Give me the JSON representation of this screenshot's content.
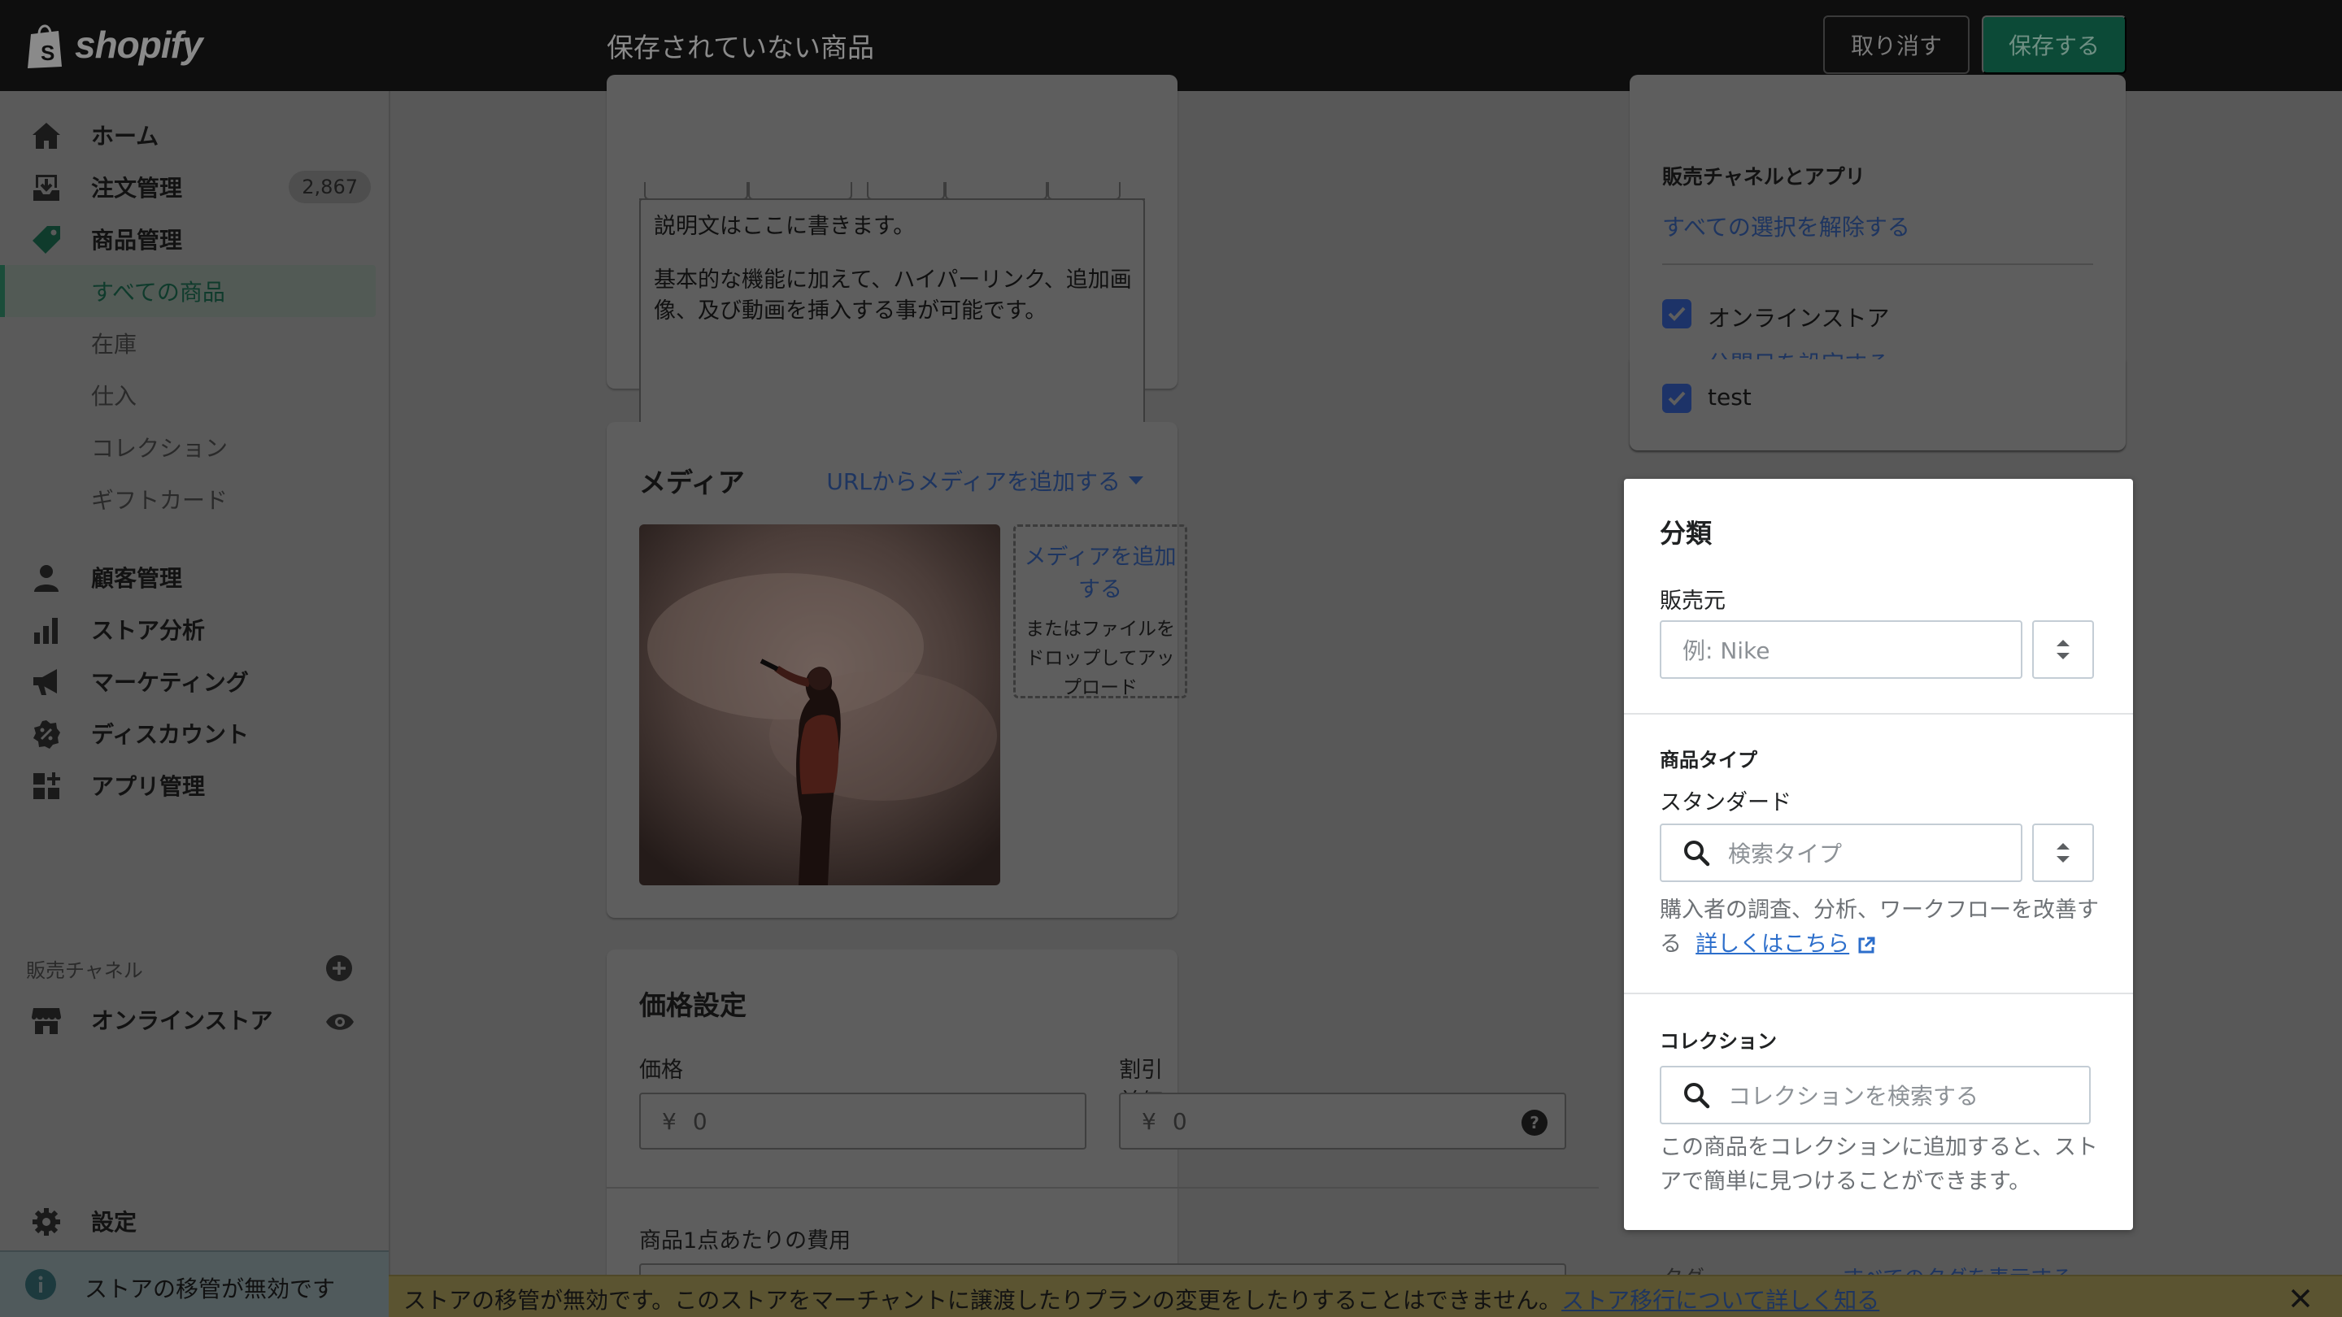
{
  "topbar": {
    "logo_text": "shopify",
    "page_title": "保存されていない商品",
    "discard_label": "取り消す",
    "save_label": "保存する"
  },
  "sidebar": {
    "items": [
      {
        "label": "ホーム",
        "icon": "home-icon"
      },
      {
        "label": "注文管理",
        "icon": "orders-icon",
        "badge": "2,867"
      },
      {
        "label": "商品管理",
        "icon": "tag-icon"
      }
    ],
    "product_subitems": [
      {
        "label": "すべての商品",
        "active": true
      },
      {
        "label": "在庫"
      },
      {
        "label": "仕入"
      },
      {
        "label": "コレクション"
      },
      {
        "label": "ギフトカード"
      }
    ],
    "items2": [
      {
        "label": "顧客管理",
        "icon": "person-icon"
      },
      {
        "label": "ストア分析",
        "icon": "bar-chart-icon"
      },
      {
        "label": "マーケティング",
        "icon": "megaphone-icon"
      },
      {
        "label": "ディスカウント",
        "icon": "discount-icon"
      },
      {
        "label": "アプリ管理",
        "icon": "apps-icon"
      }
    ],
    "channels_section": "販売チャネル",
    "online_store": "オンラインストア",
    "settings": "設定",
    "migration_note": "ストアの移管が無効です"
  },
  "description": {
    "line1": "説明文はここに書きます。",
    "line2": "基本的な機能に加えて、ハイパーリンク、追加画像、及び動画を挿入する事が可能です。"
  },
  "media": {
    "title": "メディア",
    "add_from_url": "URLからメディアを追加する",
    "dropzone_link": "メディアを追加する",
    "dropzone_text": "またはファイルをドロップしてアップロード"
  },
  "pricing": {
    "title": "価格設定",
    "price_label": "価格",
    "price_prefix": "¥",
    "price_value": "0",
    "compare_label": "割引前価格",
    "compare_prefix": "¥",
    "compare_value": "0",
    "cost_label": "商品1点あたりの費用"
  },
  "channels": {
    "label": "販売チャネルとアプリ",
    "deselect_all": "すべての選択を解除する",
    "online_store": "オンラインストア",
    "set_publish_date": "公開日を設定する",
    "test": "test"
  },
  "classification": {
    "title": "分類",
    "vendor_label": "販売元",
    "vendor_placeholder": "例: Nike",
    "product_type_label": "商品タイプ",
    "product_type_value": "スタンダード",
    "type_search_placeholder": "検索タイプ",
    "type_help": "購入者の調査、分析、ワークフローを改善する",
    "learn_more": "詳しくはこちら",
    "collections_label": "コレクション",
    "collections_placeholder": "コレクションを検索する",
    "collections_help": "この商品をコレクションに追加すると、ストアで簡単に見つけることができます。",
    "tags_label": "タグ",
    "view_all_tags": "すべてのタグを表示する"
  },
  "banner": {
    "text": "ストアの移管が無効です。このストアをマーチャントに譲渡したりプランの変更をしたりすることはできません。",
    "link": "ストア移行について詳しく知る"
  },
  "colors": {
    "shopify_green": "#008060",
    "link_blue": "#2c6ecb",
    "checkbox_blue": "#2c6ecb"
  }
}
